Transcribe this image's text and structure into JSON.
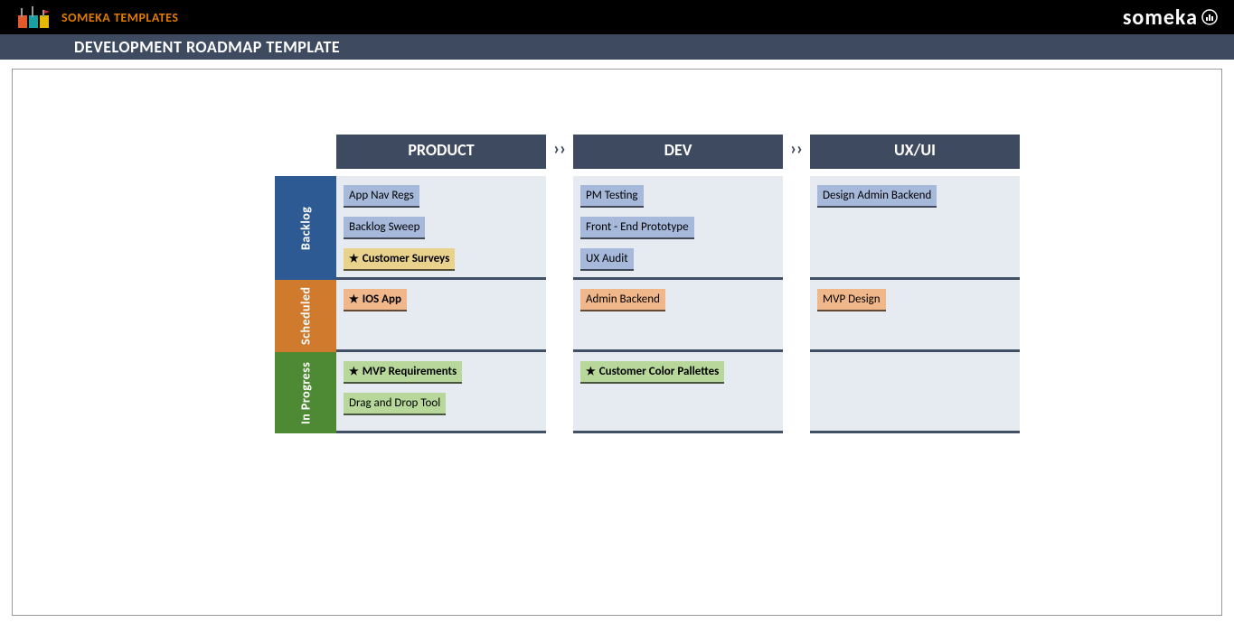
{
  "brand": {
    "name": "SOMEKA TEMPLATES",
    "logo_text": "someka"
  },
  "header": {
    "title": "DEVELOPMENT ROADMAP TEMPLATE"
  },
  "columns": [
    {
      "key": "product",
      "label": "PRODUCT"
    },
    {
      "key": "dev",
      "label": "DEV"
    },
    {
      "key": "uxui",
      "label": "UX/UI"
    }
  ],
  "rows": [
    {
      "key": "backlog",
      "label": "Backlog"
    },
    {
      "key": "scheduled",
      "label": "Scheduled"
    },
    {
      "key": "progress",
      "label": "In Progress"
    }
  ],
  "chevron": "››",
  "cells": {
    "backlog": {
      "product": [
        {
          "label": "App Nav Regs",
          "color": "blue",
          "star": false,
          "bold": false
        },
        {
          "label": "Backlog Sweep",
          "color": "blue",
          "star": false,
          "bold": false
        },
        {
          "label": "Customer Surveys",
          "color": "gold",
          "star": true,
          "bold": true
        }
      ],
      "dev": [
        {
          "label": "PM Testing",
          "color": "blue",
          "star": false,
          "bold": false
        },
        {
          "label": "Front - End Prototype",
          "color": "blue",
          "star": false,
          "bold": false
        },
        {
          "label": "UX Audit",
          "color": "blue",
          "star": false,
          "bold": false
        }
      ],
      "uxui": [
        {
          "label": "Design Admin Backend",
          "color": "blue",
          "star": false,
          "bold": false
        }
      ]
    },
    "scheduled": {
      "product": [
        {
          "label": "IOS App",
          "color": "orange",
          "star": true,
          "bold": true
        }
      ],
      "dev": [
        {
          "label": "Admin Backend",
          "color": "orange",
          "star": false,
          "bold": false
        }
      ],
      "uxui": [
        {
          "label": "MVP Design",
          "color": "orange",
          "star": false,
          "bold": false
        }
      ]
    },
    "progress": {
      "product": [
        {
          "label": "MVP Requirements",
          "color": "green",
          "star": true,
          "bold": true
        },
        {
          "label": "Drag and Drop Tool",
          "color": "green",
          "star": false,
          "bold": false
        }
      ],
      "dev": [
        {
          "label": "Customer Color Pallettes",
          "color": "green",
          "star": true,
          "bold": true
        }
      ],
      "uxui": []
    }
  },
  "row_heights": {
    "backlog": 115,
    "scheduled": 80,
    "progress": 90
  }
}
